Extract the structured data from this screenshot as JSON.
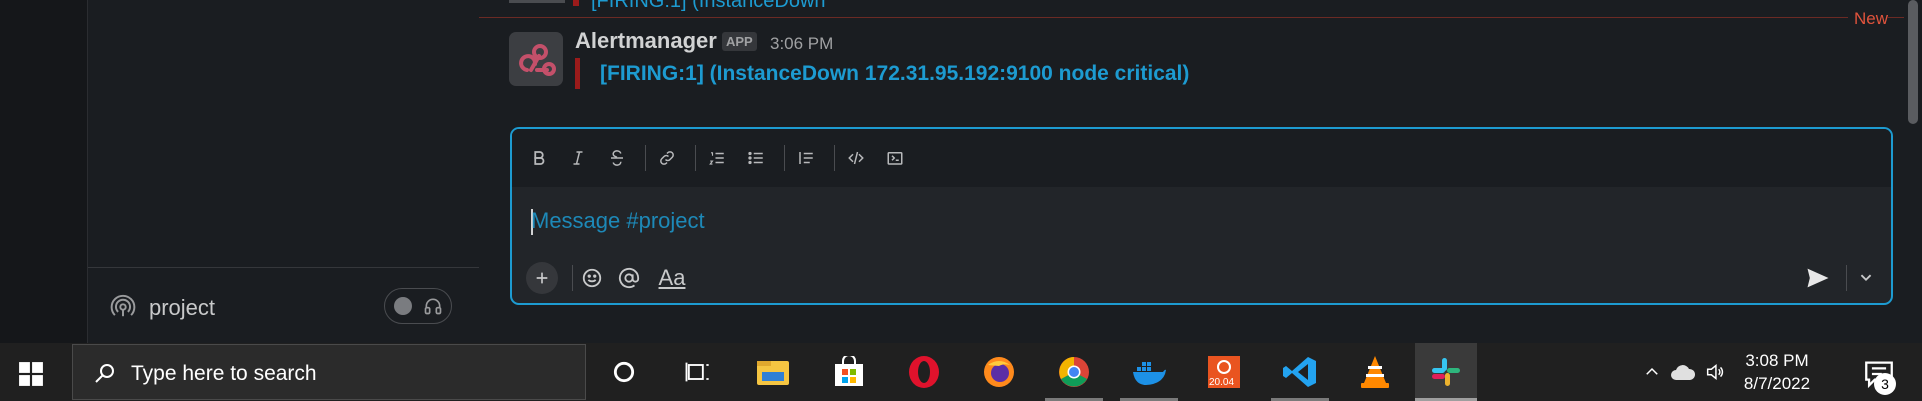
{
  "sidebar": {
    "huddle": {
      "channel_name": "project"
    }
  },
  "channel": {
    "previous_message_snippet": "[FIRING:1] (InstanceDown",
    "new_divider_label": "New",
    "message": {
      "sender": "Alertmanager",
      "badge": "APP",
      "time": "3:06 PM",
      "text": "[FIRING:1]  (InstanceDown 172.31.95.192:9100 node critical)",
      "accent_color": "#9b1b1b",
      "link_color": "#1d9bd1"
    }
  },
  "composer": {
    "placeholder": "Message #project",
    "format_buttons": [
      "bold",
      "italic",
      "strikethrough",
      "link",
      "ordered-list",
      "bulleted-list",
      "blockquote",
      "code",
      "code-block"
    ],
    "text_format_label": "Aa",
    "border_color": "#1d9bd1"
  },
  "taskbar": {
    "search_placeholder": "Type here to search",
    "apps": [
      "cortana",
      "task-view",
      "file-explorer",
      "microsoft-store",
      "opera",
      "firefox",
      "chrome",
      "docker",
      "ubuntu",
      "vscode",
      "vlc",
      "slack"
    ],
    "ubuntu_version": "20.04",
    "clock": {
      "time": "3:08 PM",
      "date": "8/7/2022"
    },
    "notification_count": "3"
  }
}
